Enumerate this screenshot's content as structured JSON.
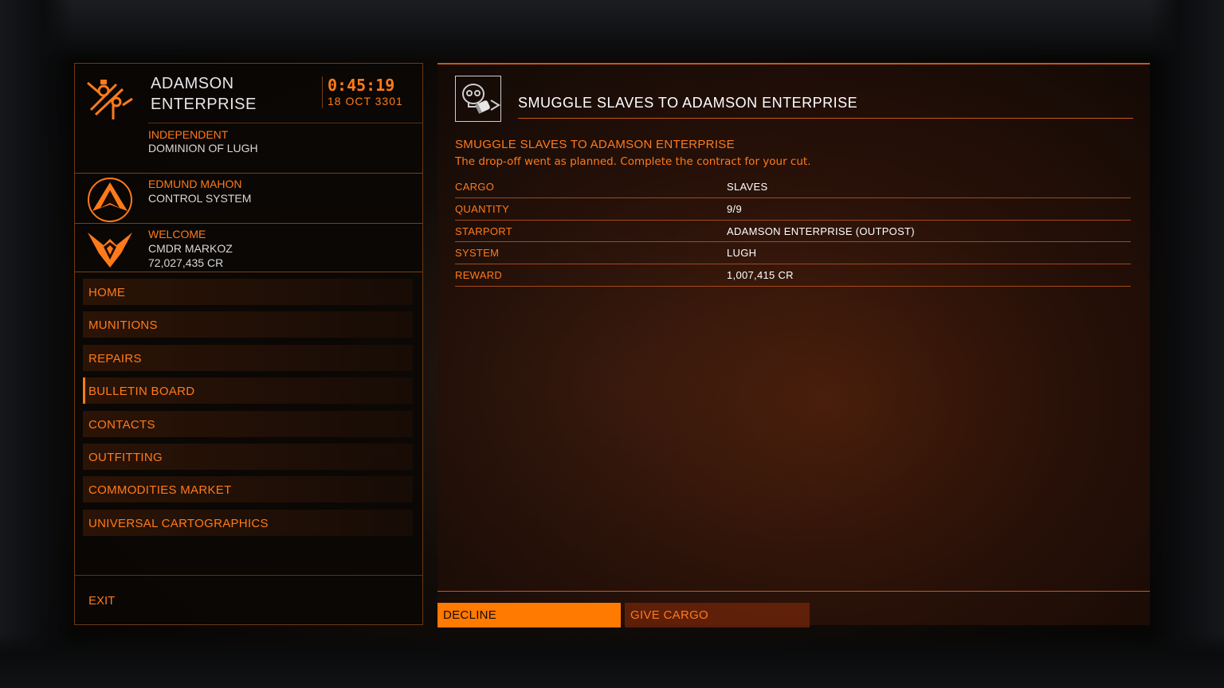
{
  "station": {
    "name": "ADAMSON ENTERPRISE",
    "time": "0:45:19",
    "date": "18 OCT 3301",
    "faction_allegiance": "INDEPENDENT",
    "faction_name": "DOMINION OF LUGH"
  },
  "power": {
    "name": "EDMUND MAHON",
    "status": "CONTROL SYSTEM"
  },
  "commander": {
    "greeting": "WELCOME",
    "name": "CMDR MARKOZ",
    "credits": "72,027,435 CR"
  },
  "menu": {
    "items": [
      {
        "label": "HOME"
      },
      {
        "label": "MUNITIONS"
      },
      {
        "label": "REPAIRS"
      },
      {
        "label": "BULLETIN BOARD"
      },
      {
        "label": "CONTACTS"
      },
      {
        "label": "OUTFITTING"
      },
      {
        "label": "COMMODITIES MARKET"
      },
      {
        "label": "UNIVERSAL CARTOGRAPHICS"
      }
    ],
    "active": "BULLETIN BOARD",
    "exit_label": "EXIT"
  },
  "mission": {
    "icon": "skull-smuggle-icon",
    "header": "SMUGGLE SLAVES TO ADAMSON ENTERPRISE",
    "title": "SMUGGLE SLAVES TO ADAMSON ENTERPRISE",
    "description": "The drop-off went as planned. Complete the contract for your cut.",
    "details": [
      {
        "label": "CARGO",
        "value": "SLAVES"
      },
      {
        "label": "QUANTITY",
        "value": "9/9"
      },
      {
        "label": "STARPORT",
        "value": "ADAMSON ENTERPRISE (OUTPOST)"
      },
      {
        "label": "SYSTEM",
        "value": "LUGH"
      },
      {
        "label": "REWARD",
        "value": "1,007,415 CR"
      }
    ]
  },
  "actions": {
    "decline_label": "DECLINE",
    "give_cargo_label": "GIVE CARGO"
  },
  "colors": {
    "accent": "#ff7a1a",
    "active_button": "#ff7a00",
    "text_white": "#ffffff"
  }
}
